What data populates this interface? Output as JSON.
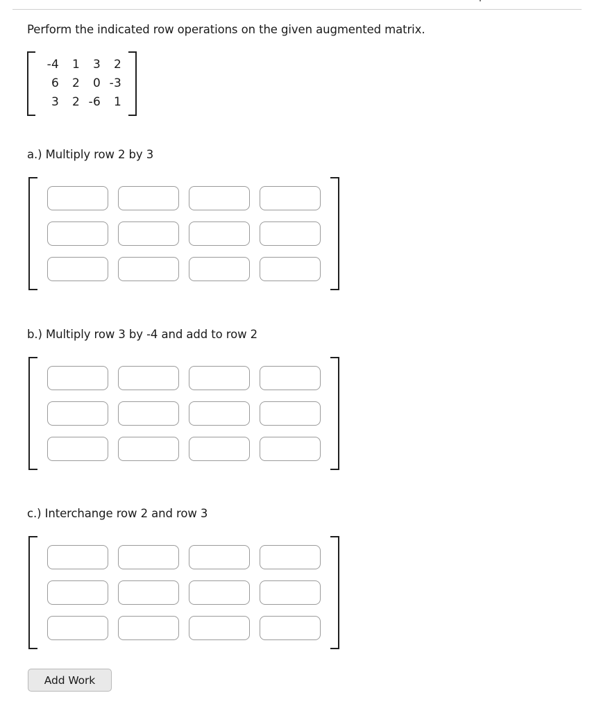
{
  "page": {
    "prompt": "Perform the indicated row operations on the given augmented matrix.",
    "clipped_top_fragment": "I",
    "clipped_top_faint_fragment": "—"
  },
  "given_matrix": {
    "rows": [
      [
        "-4",
        "1",
        "3",
        "2"
      ],
      [
        "6",
        "2",
        "0",
        "-3"
      ],
      [
        "3",
        "2",
        "-6",
        "1"
      ]
    ]
  },
  "parts": [
    {
      "id": "a",
      "label": "a.) Multiply row 2 by 3",
      "answer_rows": [
        [
          "",
          "",
          "",
          ""
        ],
        [
          "",
          "",
          "",
          ""
        ],
        [
          "",
          "",
          "",
          ""
        ]
      ]
    },
    {
      "id": "b",
      "label": "b.) Multiply row 3 by -4 and add to row 2",
      "answer_rows": [
        [
          "",
          "",
          "",
          ""
        ],
        [
          "",
          "",
          "",
          ""
        ],
        [
          "",
          "",
          "",
          ""
        ]
      ]
    },
    {
      "id": "c",
      "label": "c.) Interchange row 2 and row 3",
      "answer_rows": [
        [
          "",
          "",
          "",
          ""
        ],
        [
          "",
          "",
          "",
          ""
        ],
        [
          "",
          "",
          "",
          ""
        ]
      ]
    }
  ],
  "buttons": {
    "add_work": "Add Work"
  },
  "colors": {
    "text": "#1a1a1a",
    "divider": "#cfcfcf",
    "input_border": "#9a9a9a",
    "bracket": "#1f1f1f",
    "button_bg": "#e9e9e9",
    "button_border": "#b8b8b8"
  },
  "layout": {
    "part_label_tops": [
      213,
      472,
      730
    ],
    "part_matrix_tops": [
      255,
      514,
      772
    ]
  }
}
